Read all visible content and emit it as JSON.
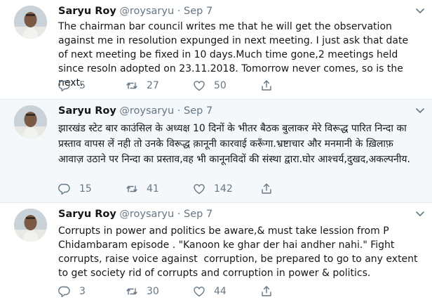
{
  "tweets": [
    {
      "name": "Saryu Roy",
      "handle": "@roysaryu",
      "sep": "·",
      "date": "Sep 7",
      "text": "The chairman bar council writes me that he will get the observation against me in resolution expunged in next meeting. I just ask that date of next meeting be fixed in 10 days.Much time gone,2 meetings held since resoln adopted on 23.11.2018. Tomorrow never comes, so is the next.",
      "replies": "5",
      "retweets": "27",
      "likes": "50"
    },
    {
      "name": "Saryu Roy",
      "handle": "@roysaryu",
      "sep": "·",
      "date": "Sep 7",
      "text": "झारखंड स्टेट बार काउंसिल के अध्यक्ष 10 दिनों के भीतर बैठक बुलाकर मेरे विरूद्ध पारित निन्दा का प्रस्ताव वापस लें नही तो उनके विरूद्ध क़ानूनी कारवाई करूँगा.भ्रष्टाचार और मनमानी के ख़िलाफ़ आवाज़ उठाने पर निन्दा का प्रस्ताव,वह भी कानूनविदों की संस्था द्वारा.घोर आश्चर्य,दुखद,अकल्पनीय.",
      "replies": "15",
      "retweets": "41",
      "likes": "142"
    },
    {
      "name": "Saryu Roy",
      "handle": "@roysaryu",
      "sep": "·",
      "date": "Sep 7",
      "text": "Corrupts in power and politics be aware,& must take lession from P Chidambaram episode . \"Kanoon ke ghar der hai andher nahi.\" Fight corrupts, raise voice against  corruption, be prepared to go to any extent to get society rid of corrupts and corruption in power & politics.",
      "replies": "3",
      "retweets": "30",
      "likes": "44"
    }
  ],
  "icons": {
    "reply": "reply-icon",
    "retweet": "retweet-icon",
    "like": "heart-icon",
    "share": "share-icon",
    "menu": "chevron-down-icon"
  },
  "colors": {
    "icon_gray": "#657786",
    "divider": "#e6ecf0",
    "highlight_bg": "#f5f8fa"
  }
}
